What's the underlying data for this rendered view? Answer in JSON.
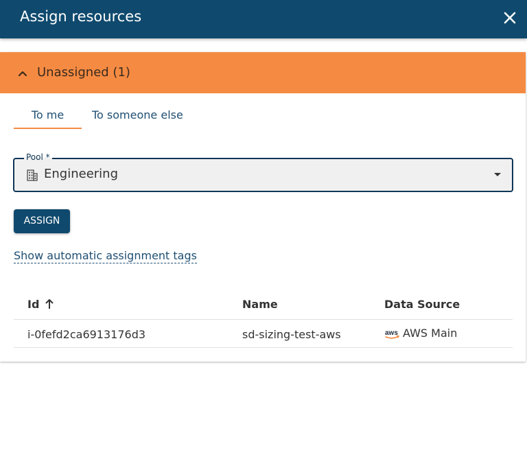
{
  "header": {
    "title": "Assign resources",
    "close_icon": "close-icon"
  },
  "section": {
    "title": "Unassigned (1)",
    "accent_color": "#f58b42"
  },
  "tabs": [
    {
      "label": "To me",
      "active": true
    },
    {
      "label": "To someone else",
      "active": false
    }
  ],
  "pool": {
    "label": "Pool *",
    "value": "Engineering",
    "icon": "building-icon"
  },
  "assign_button": {
    "label": "ASSIGN"
  },
  "tags_link": {
    "label": "Show automatic assignment tags"
  },
  "table": {
    "columns": [
      "Id",
      "Name",
      "Data Source"
    ],
    "sort": {
      "column": "Id",
      "direction": "ascending"
    },
    "rows": [
      {
        "id": "i-0fefd2ca6913176d3",
        "name": "sd-sizing-test-aws",
        "data_source": "AWS Main",
        "data_source_icon": "aws-icon"
      }
    ]
  },
  "colors": {
    "header_bg": "#0f4a6e",
    "section_bg": "#f58b42",
    "primary": "#0f4a6e"
  }
}
